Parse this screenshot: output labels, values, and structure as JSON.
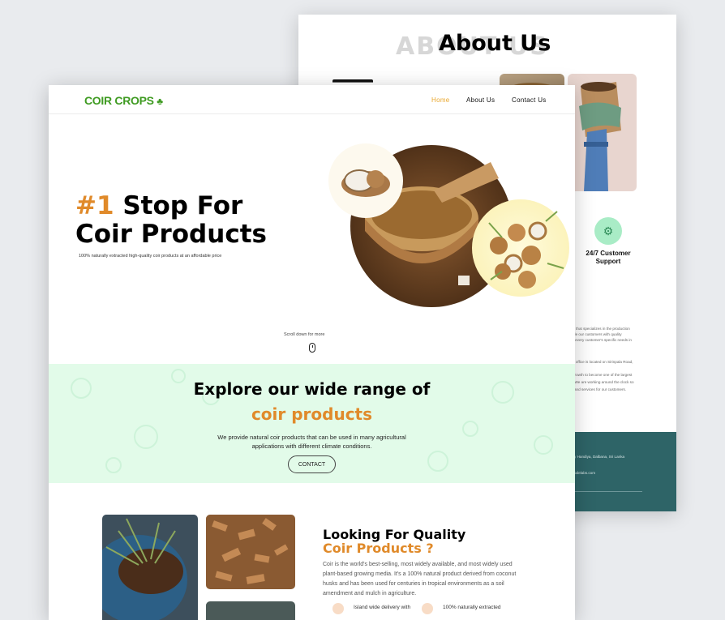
{
  "about_page": {
    "ghost_text": "ABOUT US",
    "title": "About Us",
    "support_label": "24/7 Customer Support",
    "support_icon": "tractor-icon",
    "text_fragments": [
      "ny that specializes in the production",
      "ide our customers with quality",
      "et every customer's specific needs in",
      "e office is located on Sirinpala Road,",
      "growth to become one of the largest",
      ". We are working around the clock so",
      "and services for our customers."
    ],
    "footer_fragments": [
      "y Handiya, Dalbana, Sri Lanka",
      "odelabs.com"
    ]
  },
  "nav": {
    "logo": "COIR CROPS",
    "logo_icon": "tree-icon",
    "links": [
      "Home",
      "About Us",
      "Contact Us"
    ],
    "active_color": "#e9a72c"
  },
  "hero": {
    "title_number": "#1",
    "title_rest": "Stop For",
    "title_line2": "Coir Products",
    "subtitle": "100% naturally extracted high-quality coir products at an affordable price",
    "scroll_text": "Scroll down for more"
  },
  "range": {
    "heading": "Explore our wide range of",
    "heading_highlight": "coir products",
    "description": "We provide natural coir products that can be used in many agricultural applications with different climate conditions.",
    "button": "CONTACT"
  },
  "quality": {
    "heading": "Looking For Quality",
    "heading_highlight": "Coir Products ?",
    "paragraph": "Coir is the world's best-selling, most widely available, and most widely used plant-based growing media. It's a 100% natural product derived from coconut husks and has been used for centuries in tropical environments as a soil amendment and mulch in agriculture.",
    "features": [
      "Island wide delivery with",
      "100% naturally extracted"
    ]
  },
  "colors": {
    "brand_green": "#3f9b22",
    "accent_orange": "#e08a2a",
    "band_green": "#e2fbe9",
    "footer_teal": "#2e6467"
  }
}
